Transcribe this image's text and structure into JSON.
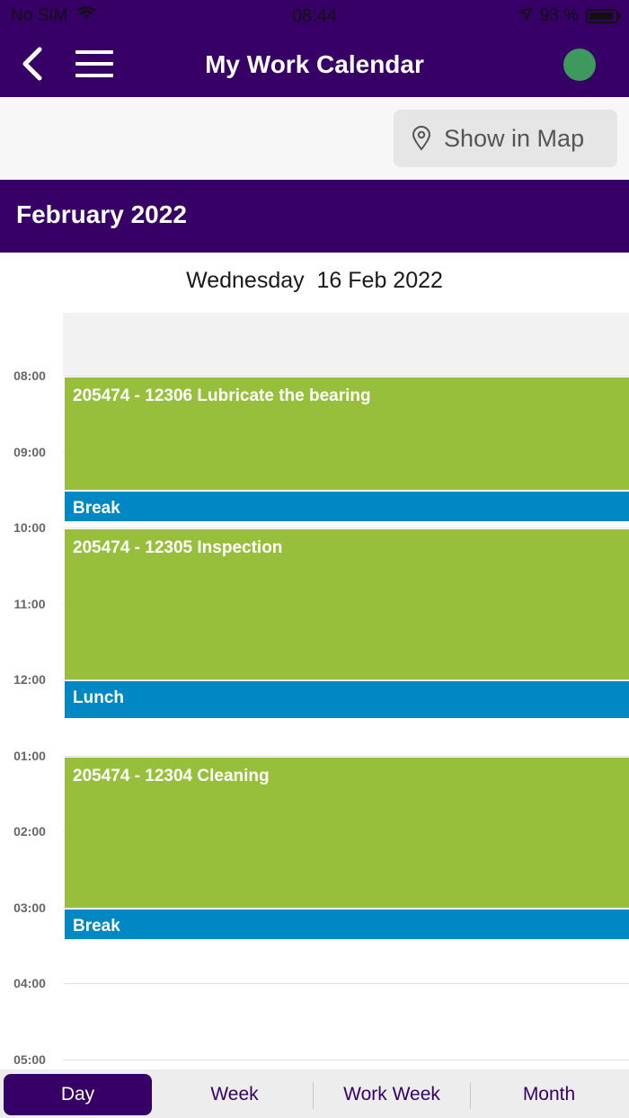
{
  "status_bar": {
    "carrier": "No SIM",
    "time": "08:44",
    "battery": "93 %"
  },
  "nav": {
    "title": "My Work Calendar",
    "status_color": "#3e9a5c"
  },
  "toolbar": {
    "map_button_label": "Show in Map"
  },
  "calendar": {
    "month_title": "February 2022",
    "day_header": "Wednesday  16 Feb 2022",
    "hour_labels": [
      "08:00",
      "09:00",
      "10:00",
      "11:00",
      "12:00",
      "01:00",
      "02:00",
      "03:00",
      "04:00",
      "05:00"
    ],
    "events": [
      {
        "title": "205474 - 12306 Lubricate the bearing",
        "kind": "task"
      },
      {
        "title": "Break",
        "kind": "break"
      },
      {
        "title": "205474 - 12305 Inspection",
        "kind": "task"
      },
      {
        "title": "Lunch",
        "kind": "break"
      },
      {
        "title": "205474 - 12304 Cleaning",
        "kind": "task"
      },
      {
        "title": "Break",
        "kind": "break"
      }
    ]
  },
  "tabs": {
    "day": "Day",
    "week": "Week",
    "work_week": "Work Week",
    "month": "Month",
    "selected": "Day"
  },
  "colors": {
    "brand": "#360066",
    "task": "#97bf3c",
    "break": "#0088c4"
  }
}
